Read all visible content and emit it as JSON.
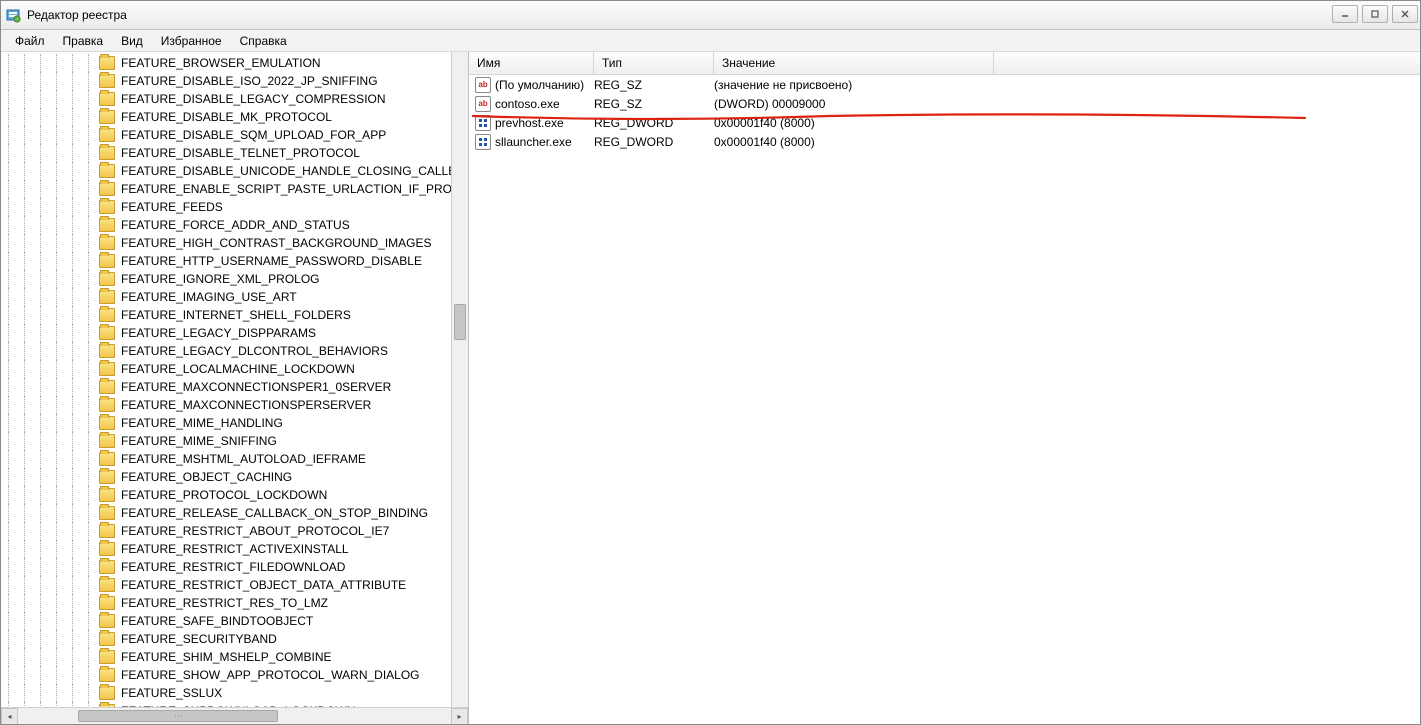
{
  "window": {
    "title": "Редактор реестра"
  },
  "menubar": {
    "items": [
      "Файл",
      "Правка",
      "Вид",
      "Избранное",
      "Справка"
    ]
  },
  "tree": {
    "indent_levels": 6,
    "items": [
      "FEATURE_BROWSER_EMULATION",
      "FEATURE_DISABLE_ISO_2022_JP_SNIFFING",
      "FEATURE_DISABLE_LEGACY_COMPRESSION",
      "FEATURE_DISABLE_MK_PROTOCOL",
      "FEATURE_DISABLE_SQM_UPLOAD_FOR_APP",
      "FEATURE_DISABLE_TELNET_PROTOCOL",
      "FEATURE_DISABLE_UNICODE_HANDLE_CLOSING_CALLBACK",
      "FEATURE_ENABLE_SCRIPT_PASTE_URLACTION_IF_PROMPT",
      "FEATURE_FEEDS",
      "FEATURE_FORCE_ADDR_AND_STATUS",
      "FEATURE_HIGH_CONTRAST_BACKGROUND_IMAGES",
      "FEATURE_HTTP_USERNAME_PASSWORD_DISABLE",
      "FEATURE_IGNORE_XML_PROLOG",
      "FEATURE_IMAGING_USE_ART",
      "FEATURE_INTERNET_SHELL_FOLDERS",
      "FEATURE_LEGACY_DISPPARAMS",
      "FEATURE_LEGACY_DLCONTROL_BEHAVIORS",
      "FEATURE_LOCALMACHINE_LOCKDOWN",
      "FEATURE_MAXCONNECTIONSPER1_0SERVER",
      "FEATURE_MAXCONNECTIONSPERSERVER",
      "FEATURE_MIME_HANDLING",
      "FEATURE_MIME_SNIFFING",
      "FEATURE_MSHTML_AUTOLOAD_IEFRAME",
      "FEATURE_OBJECT_CACHING",
      "FEATURE_PROTOCOL_LOCKDOWN",
      "FEATURE_RELEASE_CALLBACK_ON_STOP_BINDING",
      "FEATURE_RESTRICT_ABOUT_PROTOCOL_IE7",
      "FEATURE_RESTRICT_ACTIVEXINSTALL",
      "FEATURE_RESTRICT_FILEDOWNLOAD",
      "FEATURE_RESTRICT_OBJECT_DATA_ATTRIBUTE",
      "FEATURE_RESTRICT_RES_TO_LMZ",
      "FEATURE_SAFE_BINDTOOBJECT",
      "FEATURE_SECURITYBAND",
      "FEATURE_SHIM_MSHELP_COMBINE",
      "FEATURE_SHOW_APP_PROTOCOL_WARN_DIALOG",
      "FEATURE_SSLUX",
      "FEATURE_SUBDOWNLOAD_LOCKDOWN"
    ]
  },
  "list": {
    "columns": {
      "name": "Имя",
      "type": "Тип",
      "value": "Значение"
    },
    "rows": [
      {
        "icon": "sz",
        "name": "(По умолчанию)",
        "type": "REG_SZ",
        "value": "(значение не присвоено)"
      },
      {
        "icon": "sz",
        "name": "contoso.exe",
        "type": "REG_SZ",
        "value": "(DWORD) 00009000"
      },
      {
        "icon": "dw",
        "name": "prevhost.exe",
        "type": "REG_DWORD",
        "value": "0x00001f40 (8000)"
      },
      {
        "icon": "dw",
        "name": "sllauncher.exe",
        "type": "REG_DWORD",
        "value": "0x00001f40 (8000)"
      }
    ],
    "icon_glyphs": {
      "sz": "ab",
      "dw": "011\n110"
    }
  }
}
